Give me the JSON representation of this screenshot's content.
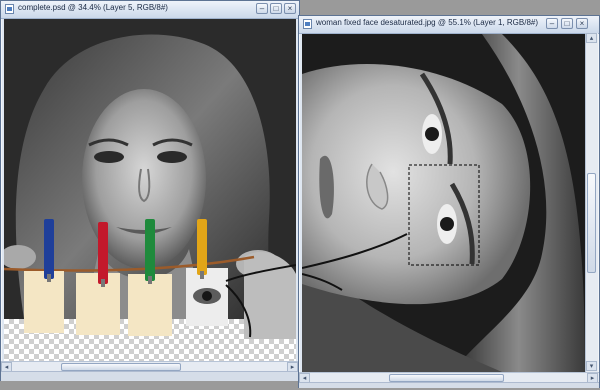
{
  "left_window": {
    "title": "complete.psd @ 34.4% (Layer 5, RGB/8#)",
    "controls": {
      "minimize": "–",
      "maximize": "□",
      "close": "×"
    },
    "scrollbar": {
      "left_arrow": "◂",
      "right_arrow": "▸"
    }
  },
  "right_window": {
    "title": "woman fixed face desaturated.jpg @ 55.1% (Layer 1, RGB/8#)",
    "controls": {
      "minimize": "–",
      "maximize": "□",
      "close": "×"
    },
    "scrollbar": {
      "left_arrow": "◂",
      "right_arrow": "▸",
      "up_arrow": "▴",
      "down_arrow": "▾"
    }
  },
  "colors": {
    "pin_blue": "#1f3f9a",
    "pin_red": "#c3192b",
    "pin_green": "#1f8a3c",
    "pin_yellow": "#e2a517",
    "string": "#9b5b2a",
    "paper": "#f4e6c4"
  }
}
